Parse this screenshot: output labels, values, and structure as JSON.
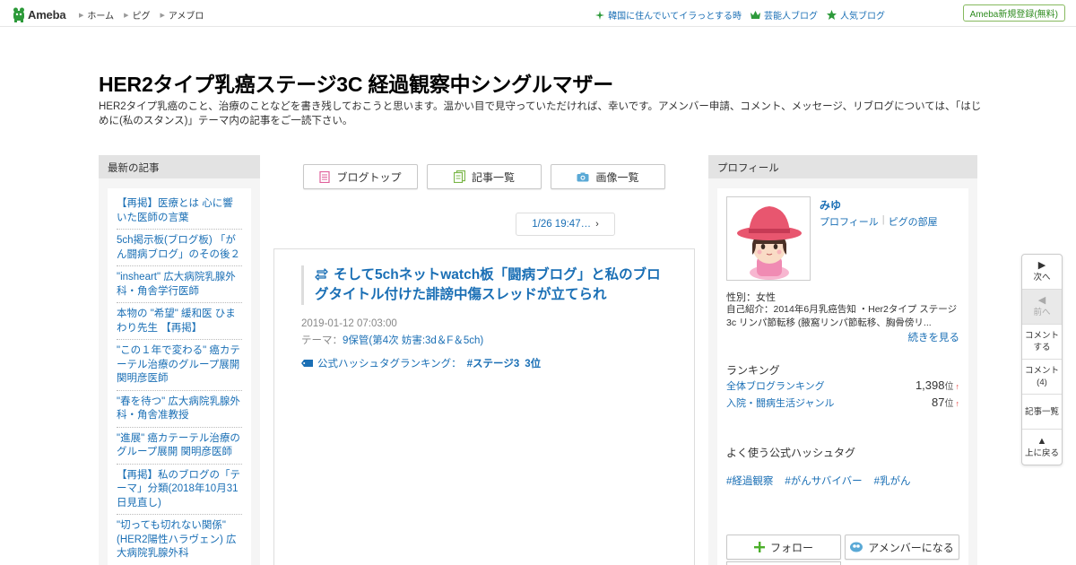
{
  "header": {
    "logo_text": "Ameba",
    "nav": [
      "ホーム",
      "ピグ",
      "アメブロ"
    ],
    "links": [
      {
        "icon": "sparkle-icon",
        "label": "韓国に住んでいてイラっとする時"
      },
      {
        "icon": "crown-icon",
        "label": "芸能人ブログ"
      },
      {
        "icon": "star-icon",
        "label": "人気ブログ"
      }
    ],
    "signup_label": "Ameba新規登録(無料)"
  },
  "blog": {
    "title": "HER2タイプ乳癌ステージ3C 経過観察中シングルマザー",
    "description": "HER2タイプ乳癌のこと、治療のことなどを書き残しておこうと思います。温かい目で見守っていただければ、幸いです。アメンバー申請、コメント、メッセージ、リブログについては、「はじめに(私のスタンス)」テーマ内の記事をご一読下さい。"
  },
  "left": {
    "heading": "最新の記事",
    "items": [
      "【再掲】医療とは 心に響いた医師の言葉",
      "5ch掲示板(ブログ板) 「がん闘病ブログ」のその後２",
      "\"insheart\" 広大病院乳腺外科・角舎学行医師",
      "本物の \"希望\" 緩和医 ひまわり先生 【再掲】",
      "\"この１年で変わる\" 癌カテーテル治療のグループ展開 関明彦医師",
      "\"春を待つ\" 広大病院乳腺外科・角舎准教授",
      "\"進展\" 癌カテーテル治療のグループ展開 関明彦医師",
      "【再掲】私のブログの「テーマ」分類(2018年10月31日見直し)",
      "\"切っても切れない関係\" (HER2陽性ハラヴェン) 広大病院乳腺外科"
    ]
  },
  "tabs": [
    {
      "icon": "document-icon",
      "label": "ブログトップ"
    },
    {
      "icon": "list-icon",
      "label": "記事一覧"
    },
    {
      "icon": "camera-icon",
      "label": "画像一覧"
    }
  ],
  "pager": {
    "label": "1/26 19:47…"
  },
  "article": {
    "title": "そして5chネットwatch板「闘病ブログ」と私のブログタイトル付けた誹謗中傷スレッドが立てられ",
    "date": "2019-01-12 07:03:00",
    "theme_prefix": "テーマ：",
    "theme": "9保管(第4次 妨害:3d＆F＆5ch)",
    "hashtag_label": "公式ハッシュタグランキング：",
    "hashtag_tag": "#ステージ3",
    "hashtag_rank": "3位"
  },
  "profile": {
    "heading": "プロフィール",
    "name": "みゆ",
    "link_profile": "プロフィール",
    "link_pigg": "ピグの部屋",
    "gender": "性別：女性",
    "intro": "自己紹介：2014年6月乳癌告知 ・Her2タイプ ステージ3c リンパ節転移 (腋窩リンパ節転移、胸骨傍リ...",
    "more": "続きを見る",
    "ranking_head": "ランキング",
    "ranks": [
      {
        "label": "全体ブログランキング",
        "value": "1,398",
        "unit": "位",
        "arrow": "↑"
      },
      {
        "label": "入院・闘病生活ジャンル",
        "value": "87",
        "unit": "位",
        "arrow": "↑"
      }
    ],
    "hashtag_head": "よく使う公式ハッシュタグ",
    "hashtags": [
      "#経過観察",
      "#がんサバイバー",
      "#乳がん"
    ],
    "follow_label": "フォロー",
    "member_label": "アメンバーになる"
  },
  "sidenav": [
    {
      "glyph": "▶",
      "label": "次へ",
      "disabled": false
    },
    {
      "glyph": "◀",
      "label": "前へ",
      "disabled": true
    },
    {
      "glyph": "",
      "label": "コメントする",
      "disabled": false
    },
    {
      "glyph": "",
      "label": "コメント(4)",
      "disabled": false
    },
    {
      "glyph": "",
      "label": "記事一覧",
      "disabled": false
    },
    {
      "glyph": "▲",
      "label": "上に戻る",
      "disabled": false
    }
  ],
  "colors": {
    "link": "#1a6fb5",
    "brand_green": "#2e8b1e",
    "rank_up": "#e53935"
  }
}
